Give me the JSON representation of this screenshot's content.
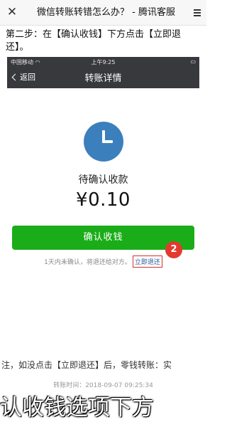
{
  "outer": {
    "title": "微信转账转错怎么办？ - 腾讯客服",
    "close_icon": "close-icon",
    "more_icon": "menu-icon"
  },
  "step_text": "第二步：在【确认收钱】下方点击【立即退还】。",
  "phone": {
    "status": {
      "carrier": "中国移动",
      "time": "上午9:25"
    },
    "nav": {
      "back_label": "返回",
      "title": "转账详情"
    },
    "status_icon": "clock-icon",
    "pending_label": "待确认收款",
    "amount": "¥0.10",
    "confirm_button": "确认收钱",
    "note": "1天内未确认，将退还给对方。",
    "refund_link": "立即退还",
    "badge_number": "2",
    "transfer_time": "转账时间：2018-09-07 09:25:34"
  },
  "bottom_note": "注，如没点击【立即退还】后，零钱转账：实",
  "overlay_caption": "认收钱选项下方",
  "colors": {
    "wechat_green": "#1aad19",
    "nav_dark": "#38393d",
    "clock_blue": "#3c7fbd",
    "badge_red": "#e23a2e"
  }
}
